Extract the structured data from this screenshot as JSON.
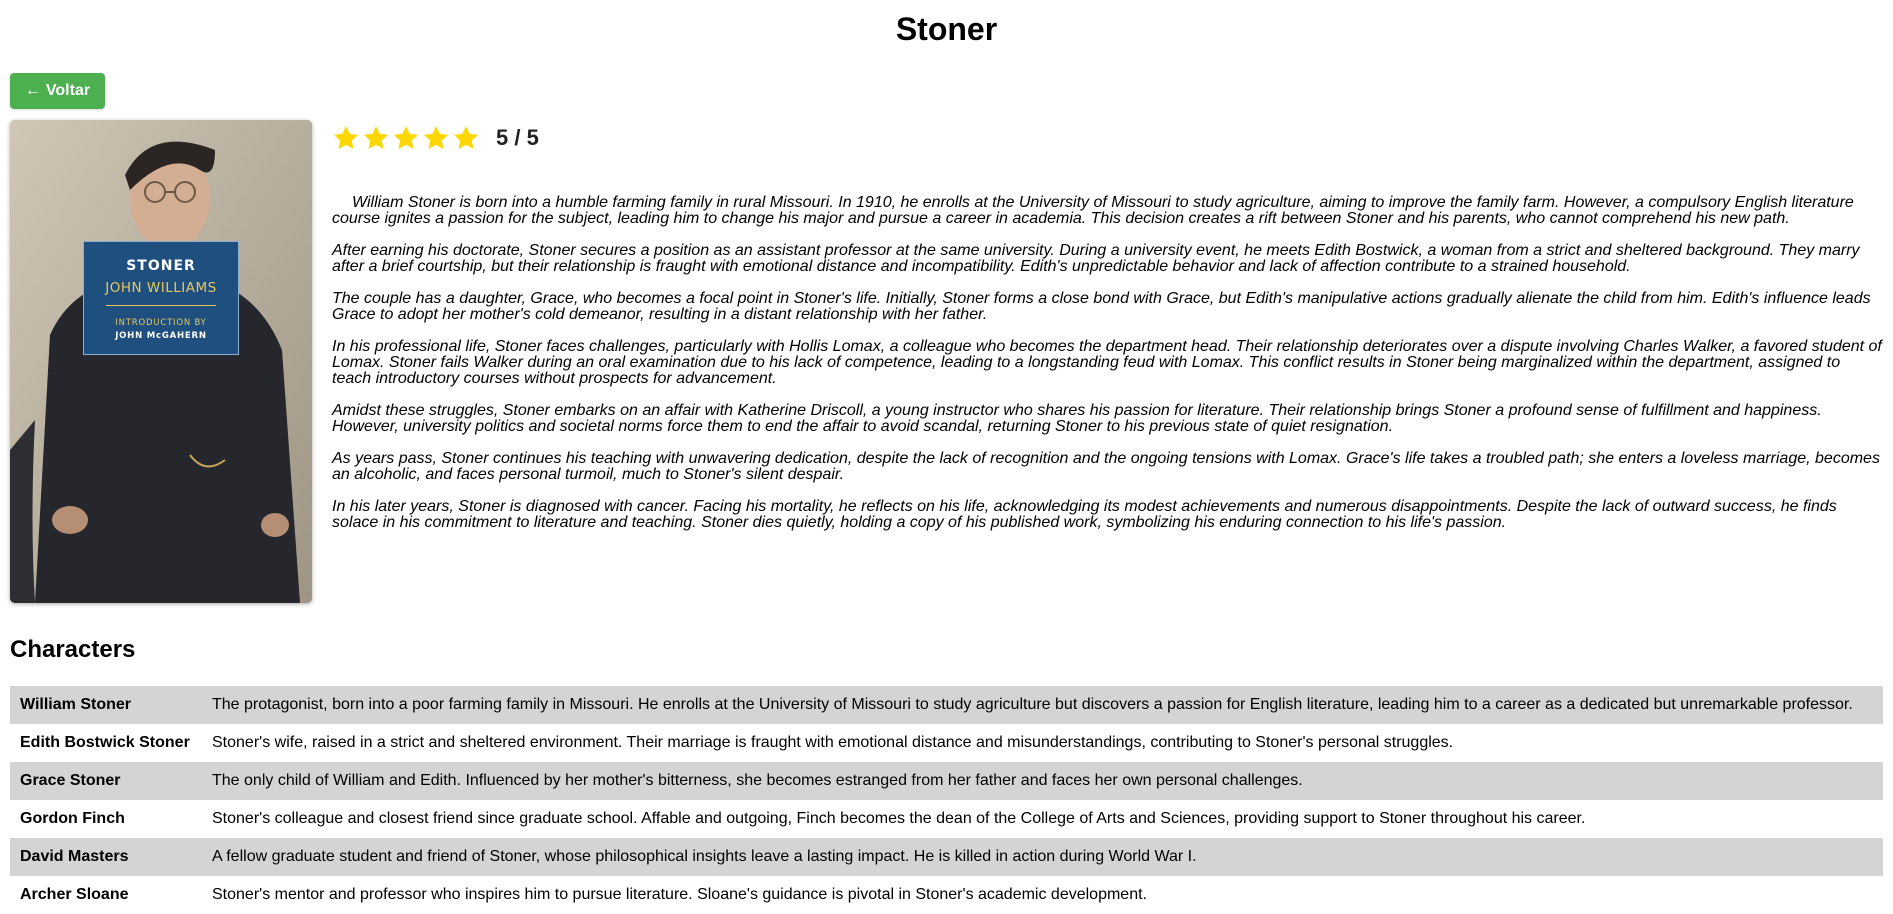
{
  "page": {
    "title": "Stoner"
  },
  "back_button": {
    "label": "Voltar",
    "icon": "left-arrow-icon",
    "color": "#4CAF50"
  },
  "cover": {
    "title": "STONER",
    "author": "JOHN WILLIAMS",
    "intro_by": "INTRODUCTION BY",
    "intro_name": "JOHN McGAHERN"
  },
  "rating": {
    "value": 5,
    "max": 5,
    "text": "5 / 5",
    "star_color": "#FFD700"
  },
  "synopsis": [
    "William Stoner is born into a humble farming family in rural Missouri. In 1910, he enrolls at the University of Missouri to study agriculture, aiming to improve the family farm. However, a compulsory English literature course ignites a passion for the subject, leading him to change his major and pursue a career in academia. This decision creates a rift between Stoner and his parents, who cannot comprehend his new path.",
    "After earning his doctorate, Stoner secures a position as an assistant professor at the same university. During a university event, he meets Edith Bostwick, a woman from a strict and sheltered background. They marry after a brief courtship, but their relationship is fraught with emotional distance and incompatibility. Edith's unpredictable behavior and lack of affection contribute to a strained household.",
    "The couple has a daughter, Grace, who becomes a focal point in Stoner's life. Initially, Stoner forms a close bond with Grace, but Edith's manipulative actions gradually alienate the child from him. Edith's influence leads Grace to adopt her mother's cold demeanor, resulting in a distant relationship with her father.",
    "In his professional life, Stoner faces challenges, particularly with Hollis Lomax, a colleague who becomes the department head. Their relationship deteriorates over a dispute involving Charles Walker, a favored student of Lomax. Stoner fails Walker during an oral examination due to his lack of competence, leading to a longstanding feud with Lomax. This conflict results in Stoner being marginalized within the department, assigned to teach introductory courses without prospects for advancement.",
    "Amidst these struggles, Stoner embarks on an affair with Katherine Driscoll, a young instructor who shares his passion for literature. Their relationship brings Stoner a profound sense of fulfillment and happiness. However, university politics and societal norms force them to end the affair to avoid scandal, returning Stoner to his previous state of quiet resignation.",
    "As years pass, Stoner continues his teaching with unwavering dedication, despite the lack of recognition and the ongoing tensions with Lomax. Grace's life takes a troubled path; she enters a loveless marriage, becomes an alcoholic, and faces personal turmoil, much to Stoner's silent despair.",
    "In his later years, Stoner is diagnosed with cancer. Facing his mortality, he reflects on his life, acknowledging its modest achievements and numerous disappointments. Despite the lack of outward success, he finds solace in his commitment to literature and teaching. Stoner dies quietly, holding a copy of his published work, symbolizing his enduring connection to his life's passion."
  ],
  "characters": {
    "heading": "Characters",
    "rows": [
      {
        "name": "William Stoner",
        "description": "The protagonist, born into a poor farming family in Missouri. He enrolls at the University of Missouri to study agriculture but discovers a passion for English literature, leading him to a career as a dedicated but unremarkable professor."
      },
      {
        "name": "Edith Bostwick Stoner",
        "description": "Stoner's wife, raised in a strict and sheltered environment. Their marriage is fraught with emotional distance and misunderstandings, contributing to Stoner's personal struggles."
      },
      {
        "name": "Grace Stoner",
        "description": "The only child of William and Edith. Influenced by her mother's bitterness, she becomes estranged from her father and faces her own personal challenges."
      },
      {
        "name": "Gordon Finch",
        "description": "Stoner's colleague and closest friend since graduate school. Affable and outgoing, Finch becomes the dean of the College of Arts and Sciences, providing support to Stoner throughout his career."
      },
      {
        "name": "David Masters",
        "description": "A fellow graduate student and friend of Stoner, whose philosophical insights leave a lasting impact. He is killed in action during World War I."
      },
      {
        "name": "Archer Sloane",
        "description": "Stoner's mentor and professor who inspires him to pursue literature. Sloane's guidance is pivotal in Stoner's academic development."
      }
    ]
  }
}
